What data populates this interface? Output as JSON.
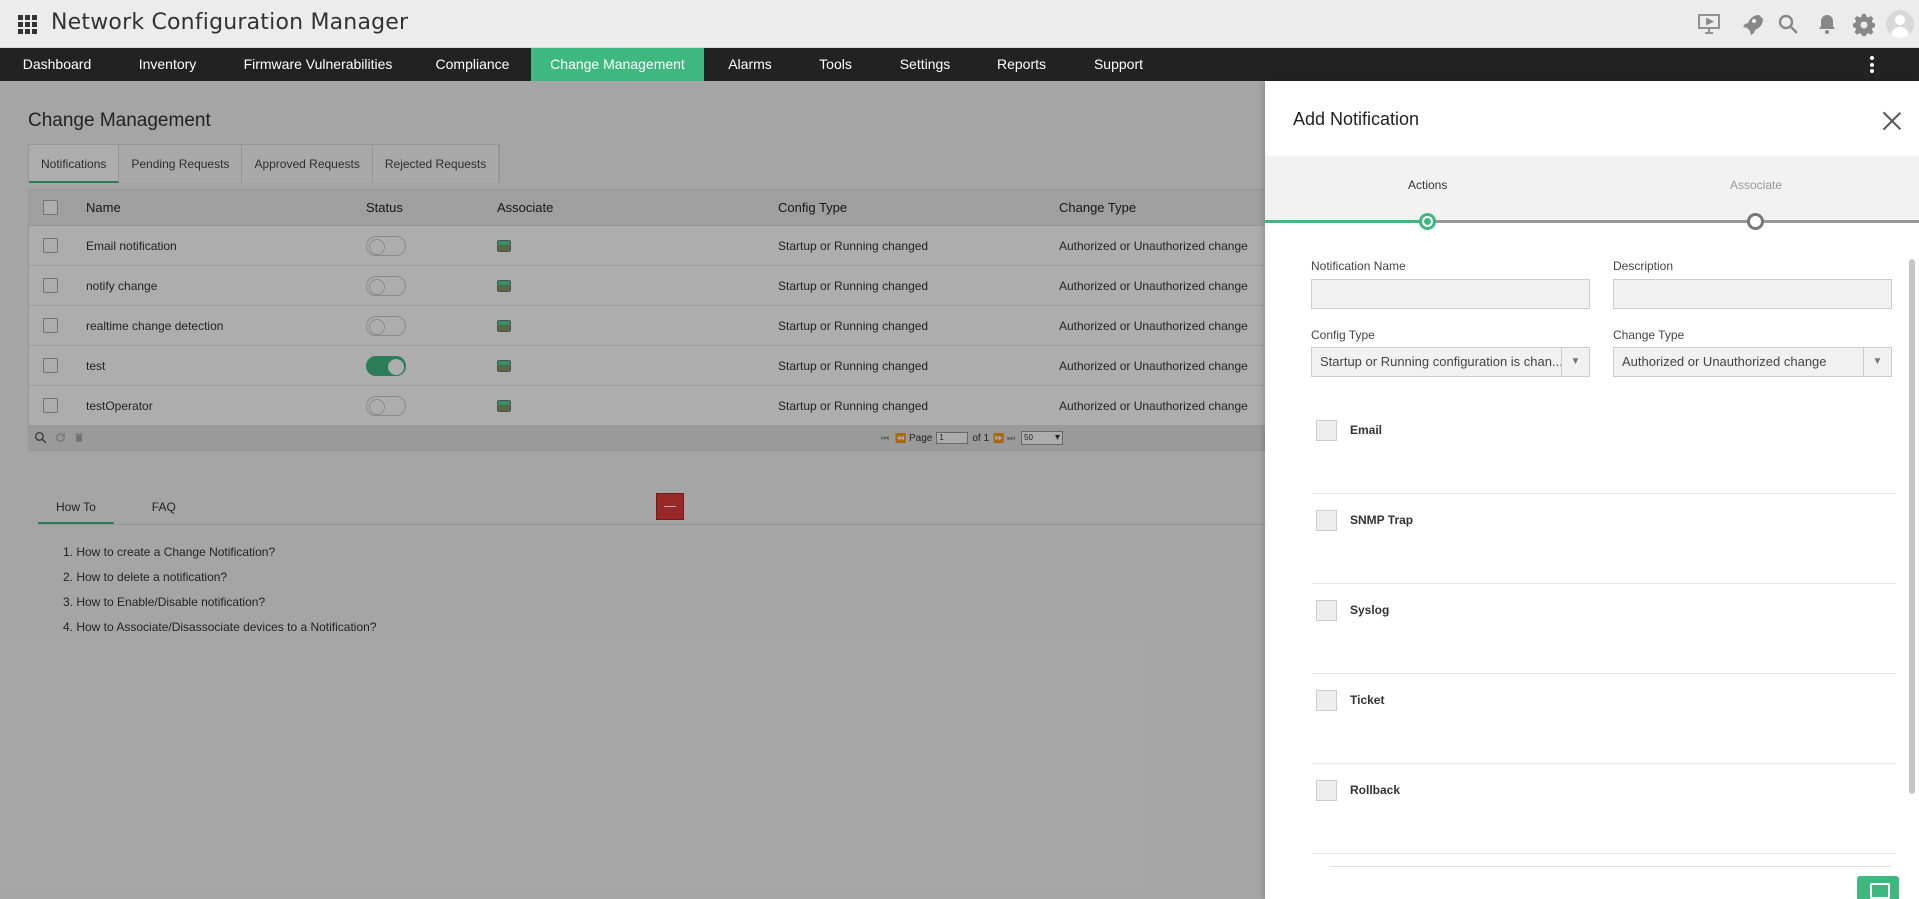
{
  "app": {
    "title": "Network Configuration Manager"
  },
  "header_icons": [
    "presentation-icon",
    "rocket-icon",
    "search-icon",
    "bell-icon",
    "gear-icon",
    "user-avatar-icon"
  ],
  "nav": {
    "items": [
      {
        "label": "Dashboard"
      },
      {
        "label": "Inventory"
      },
      {
        "label": "Firmware Vulnerabilities"
      },
      {
        "label": "Compliance"
      },
      {
        "label": "Change Management",
        "active": true
      },
      {
        "label": "Alarms"
      },
      {
        "label": "Tools"
      },
      {
        "label": "Settings"
      },
      {
        "label": "Reports"
      },
      {
        "label": "Support"
      }
    ]
  },
  "main": {
    "title": "Change Management",
    "tabs": [
      {
        "label": "Notifications",
        "active": true
      },
      {
        "label": "Pending Requests"
      },
      {
        "label": "Approved Requests"
      },
      {
        "label": "Rejected Requests"
      }
    ],
    "table": {
      "columns": [
        "Name",
        "Status",
        "Associate",
        "Config Type",
        "Change Type"
      ],
      "rows": [
        {
          "name": "Email notification",
          "status": "off",
          "config_type": "Startup or Running changed",
          "change_type": "Authorized or Unauthorized change"
        },
        {
          "name": "notify change",
          "status": "off",
          "config_type": "Startup or Running changed",
          "change_type": "Authorized or Unauthorized change"
        },
        {
          "name": "realtime change detection",
          "status": "off",
          "config_type": "Startup or Running changed",
          "change_type": "Authorized or Unauthorized change"
        },
        {
          "name": "test",
          "status": "on",
          "config_type": "Startup or Running changed",
          "change_type": "Authorized or Unauthorized change"
        },
        {
          "name": "testOperator",
          "status": "off",
          "config_type": "Startup or Running changed",
          "change_type": "Authorized or Unauthorized change"
        }
      ],
      "pager": {
        "page_label": "Page",
        "page_value": "1",
        "of_label": "of 1",
        "page_size": "50"
      }
    },
    "help": {
      "tabs": [
        {
          "label": "How To",
          "active": true
        },
        {
          "label": "FAQ"
        }
      ],
      "items": [
        "1. How to create a Change Notification?",
        "2. How to delete a notification?",
        "3. How to Enable/Disable notification?",
        "4. How to Associate/Disassociate devices to a Notification?"
      ]
    }
  },
  "panel": {
    "title": "Add Notification",
    "steps": [
      {
        "label": "Actions",
        "state": "current"
      },
      {
        "label": "Associate",
        "state": "pending"
      }
    ],
    "fields": {
      "notification_name_label": "Notification Name",
      "notification_name_value": "",
      "description_label": "Description",
      "description_value": "",
      "config_type_label": "Config Type",
      "config_type_value": "Startup or Running configuration is chan...",
      "change_type_label": "Change Type",
      "change_type_value": "Authorized or Unauthorized change"
    },
    "actions": [
      {
        "label": "Email"
      },
      {
        "label": "SNMP Trap"
      },
      {
        "label": "Syslog"
      },
      {
        "label": "Ticket"
      },
      {
        "label": "Rollback"
      }
    ]
  },
  "colors": {
    "accent": "#3fb87f",
    "nav_bg": "#222222",
    "danger": "#e03a3a"
  }
}
